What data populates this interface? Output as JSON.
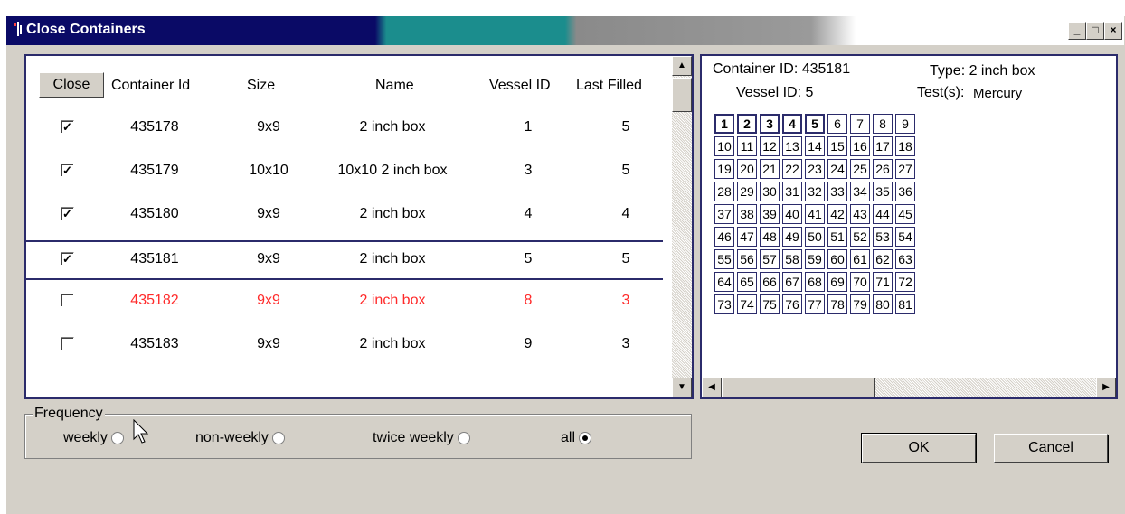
{
  "window": {
    "title": "Close Containers",
    "min_label": "_",
    "max_label": "□",
    "close_label": "×"
  },
  "table": {
    "columns": [
      "Close",
      "Container Id",
      "Size",
      "Name",
      "Vessel ID",
      "Last Filled"
    ],
    "rows": [
      {
        "checked": true,
        "id": "435178",
        "size": "9x9",
        "name": "2 inch box",
        "vessel": "1",
        "last": "5",
        "status": "normal"
      },
      {
        "checked": true,
        "id": "435179",
        "size": "10x10",
        "name": "10x10 2 inch box",
        "vessel": "3",
        "last": "5",
        "status": "normal"
      },
      {
        "checked": true,
        "id": "435180",
        "size": "9x9",
        "name": "2 inch box",
        "vessel": "4",
        "last": "4",
        "status": "normal"
      },
      {
        "checked": true,
        "id": "435181",
        "size": "9x9",
        "name": "2 inch box",
        "vessel": "5",
        "last": "5",
        "status": "selected"
      },
      {
        "checked": false,
        "id": "435182",
        "size": "9x9",
        "name": "2 inch box",
        "vessel": "8",
        "last": "3",
        "status": "alert"
      },
      {
        "checked": false,
        "id": "435183",
        "size": "9x9",
        "name": "2 inch box",
        "vessel": "9",
        "last": "3",
        "status": "normal"
      }
    ]
  },
  "detail": {
    "container_id_label": "Container ID: 435181",
    "type_label": "Type: 2 inch box",
    "vessel_label": "Vessel ID: 5",
    "tests_label": "Test(s):",
    "tests_value": "Mercury",
    "filled_count": 5,
    "cells": [
      "1",
      "2",
      "3",
      "4",
      "5",
      "6",
      "7",
      "8",
      "9",
      "10",
      "11",
      "12",
      "13",
      "14",
      "15",
      "16",
      "17",
      "18",
      "19",
      "20",
      "21",
      "22",
      "23",
      "24",
      "25",
      "26",
      "27",
      "28",
      "29",
      "30",
      "31",
      "32",
      "33",
      "34",
      "35",
      "36",
      "37",
      "38",
      "39",
      "40",
      "41",
      "42",
      "43",
      "44",
      "45",
      "46",
      "47",
      "48",
      "49",
      "50",
      "51",
      "52",
      "53",
      "54",
      "55",
      "56",
      "57",
      "58",
      "59",
      "60",
      "61",
      "62",
      "63",
      "64",
      "65",
      "66",
      "67",
      "68",
      "69",
      "70",
      "71",
      "72",
      "73",
      "74",
      "75",
      "76",
      "77",
      "78",
      "79",
      "80",
      "81"
    ]
  },
  "frequency": {
    "legend": "Frequency",
    "options": [
      {
        "label": "weekly",
        "selected": false
      },
      {
        "label": "non-weekly",
        "selected": false
      },
      {
        "label": "twice weekly",
        "selected": false
      },
      {
        "label": "all",
        "selected": true
      }
    ]
  },
  "buttons": {
    "ok": "OK",
    "cancel": "Cancel"
  },
  "colors": {
    "alert_text": "#ff2a2a",
    "frame_border": "#2b2b6b"
  }
}
